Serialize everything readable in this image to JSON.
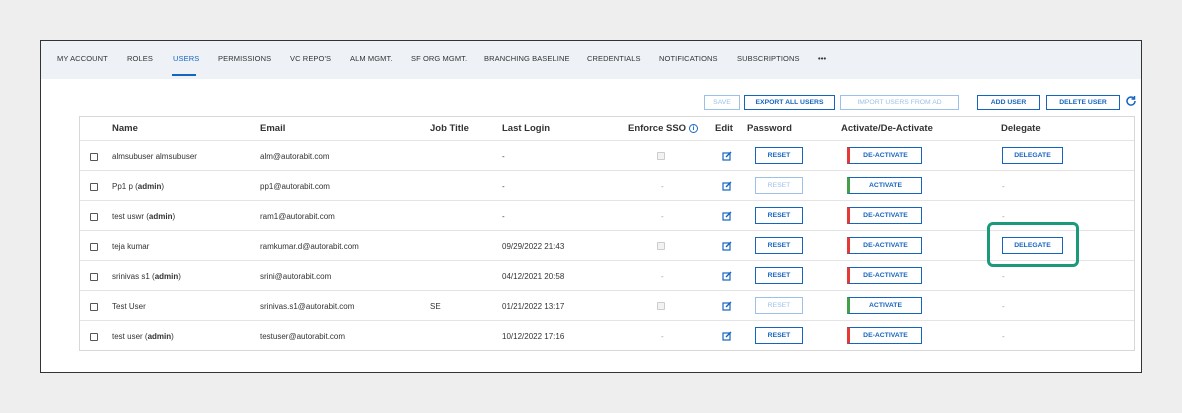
{
  "tabs": [
    {
      "label": "MY ACCOUNT"
    },
    {
      "label": "ROLES"
    },
    {
      "label": "USERS"
    },
    {
      "label": "PERMISSIONS"
    },
    {
      "label": "VC REPO'S"
    },
    {
      "label": "ALM MGMT."
    },
    {
      "label": "SF ORG MGMT."
    },
    {
      "label": "BRANCHING BASELINE"
    },
    {
      "label": "CREDENTIALS"
    },
    {
      "label": "NOTIFICATIONS"
    },
    {
      "label": "SUBSCRIPTIONS"
    },
    {
      "label": "•••"
    }
  ],
  "active_tab": "USERS",
  "toolbar": {
    "save": "SAVE",
    "export_all": "EXPORT ALL USERS",
    "import_ad": "IMPORT USERS FROM AD",
    "add_user": "ADD USER",
    "delete_user": "DELETE USER",
    "refresh_icon": "refresh-icon"
  },
  "columns": {
    "name": "Name",
    "email": "Email",
    "job_title": "Job Title",
    "last_login": "Last Login",
    "enforce_sso": "Enforce SSO",
    "edit": "Edit",
    "password": "Password",
    "activate": "Activate/De-Activate",
    "delegate": "Delegate"
  },
  "rows": [
    {
      "name": "almsubuser almsubuser",
      "admin": "",
      "email": "alm@autorabit.com",
      "job_title": "",
      "last_login": "-",
      "sso": "checkbox",
      "password_label": "RESET",
      "password_enabled": true,
      "activate_label": "DE-ACTIVATE",
      "activate_state": "red",
      "delegate": "DELEGATE"
    },
    {
      "name": "Pp1 p",
      "admin": "admin",
      "email": "pp1@autorabit.com",
      "job_title": "",
      "last_login": "-",
      "sso": "-",
      "password_label": "RESET",
      "password_enabled": false,
      "activate_label": "ACTIVATE",
      "activate_state": "green",
      "delegate": "-"
    },
    {
      "name": "test uswr",
      "admin": "admin",
      "email": "ram1@autorabit.com",
      "job_title": "",
      "last_login": "-",
      "sso": "-",
      "password_label": "RESET",
      "password_enabled": true,
      "activate_label": "DE-ACTIVATE",
      "activate_state": "red",
      "delegate": "-"
    },
    {
      "name": "teja kumar",
      "admin": "",
      "email": "ramkumar.d@autorabit.com",
      "job_title": "",
      "last_login": "09/29/2022 21:43",
      "sso": "checkbox",
      "password_label": "RESET",
      "password_enabled": true,
      "activate_label": "DE-ACTIVATE",
      "activate_state": "red",
      "delegate": "DELEGATE"
    },
    {
      "name": "srinivas s1",
      "admin": "admin",
      "email": "srini@autorabit.com",
      "job_title": "",
      "last_login": "04/12/2021 20:58",
      "sso": "-",
      "password_label": "RESET",
      "password_enabled": true,
      "activate_label": "DE-ACTIVATE",
      "activate_state": "red",
      "delegate": "-"
    },
    {
      "name": "Test User",
      "admin": "",
      "email": "srinivas.s1@autorabit.com",
      "job_title": "SE",
      "last_login": "01/21/2022 13:17",
      "sso": "checkbox",
      "password_label": "RESET",
      "password_enabled": false,
      "activate_label": "ACTIVATE",
      "activate_state": "green",
      "delegate": "-"
    },
    {
      "name": "test user",
      "admin": "admin",
      "email": "testuser@autorabit.com",
      "job_title": "",
      "last_login": "10/12/2022 17:16",
      "sso": "-",
      "password_label": "RESET",
      "password_enabled": true,
      "activate_label": "DE-ACTIVATE",
      "activate_state": "red",
      "delegate": "-"
    }
  ],
  "colors": {
    "accent": "#1565c0",
    "deactivate_stripe": "#e53935",
    "activate_stripe": "#43a047",
    "highlight": "#1a9a7a"
  }
}
